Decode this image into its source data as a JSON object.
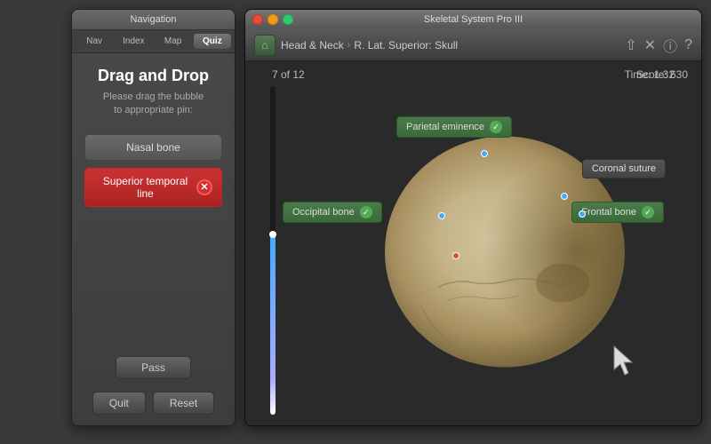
{
  "nav_panel": {
    "title": "Navigation",
    "tabs": [
      "Nav",
      "Index",
      "Map",
      "Quiz"
    ],
    "active_tab": "Quiz",
    "heading": "Drag and Drop",
    "subtext": "Please drag the bubble\nto appropriate pin:",
    "answers": [
      {
        "label": "Nasal bone",
        "state": "normal"
      },
      {
        "label": "Superior temporal line",
        "state": "wrong"
      }
    ],
    "pass_btn": "Pass",
    "quit_btn": "Quit",
    "reset_btn": "Reset"
  },
  "main_panel": {
    "title": "Skeletal System Pro III",
    "breadcrumb": {
      "home": "🏠",
      "section": "Head & Neck",
      "subsection": "R. Lat. Superior: Skull"
    },
    "progress": {
      "current": 7,
      "total": 12,
      "label": "7 of 12"
    },
    "timer": "Time: 1:32",
    "score": "Score: 630",
    "labels": [
      {
        "text": "Parietal eminence",
        "state": "correct"
      },
      {
        "text": "Coronal suture",
        "state": "dark"
      },
      {
        "text": "Occipital bone",
        "state": "correct"
      },
      {
        "text": "Frontal bone",
        "state": "correct"
      }
    ]
  },
  "icons": {
    "share": "⇧",
    "tools": "✕",
    "info": "ⓘ",
    "help": "?"
  }
}
